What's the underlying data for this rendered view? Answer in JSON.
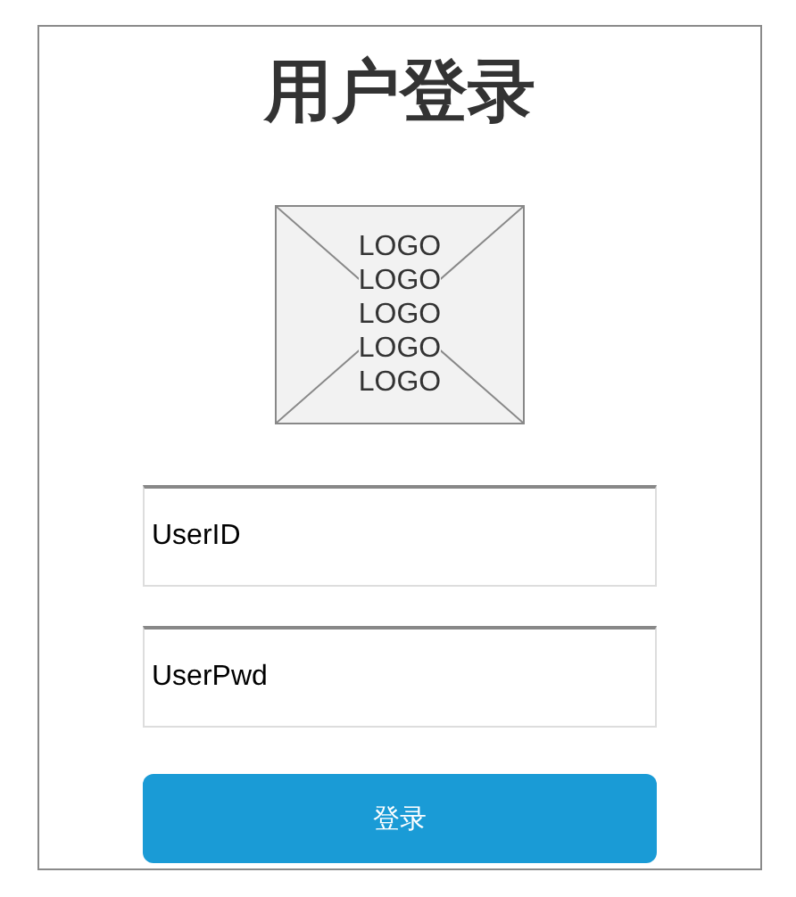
{
  "title": "用户登录",
  "logo": {
    "lines": [
      "LOGO",
      "LOGO",
      "LOGO",
      "LOGO",
      "LOGO"
    ]
  },
  "fields": [
    {
      "value": "UserID"
    },
    {
      "value": "UserPwd"
    }
  ],
  "login_button": {
    "label": "登录"
  }
}
